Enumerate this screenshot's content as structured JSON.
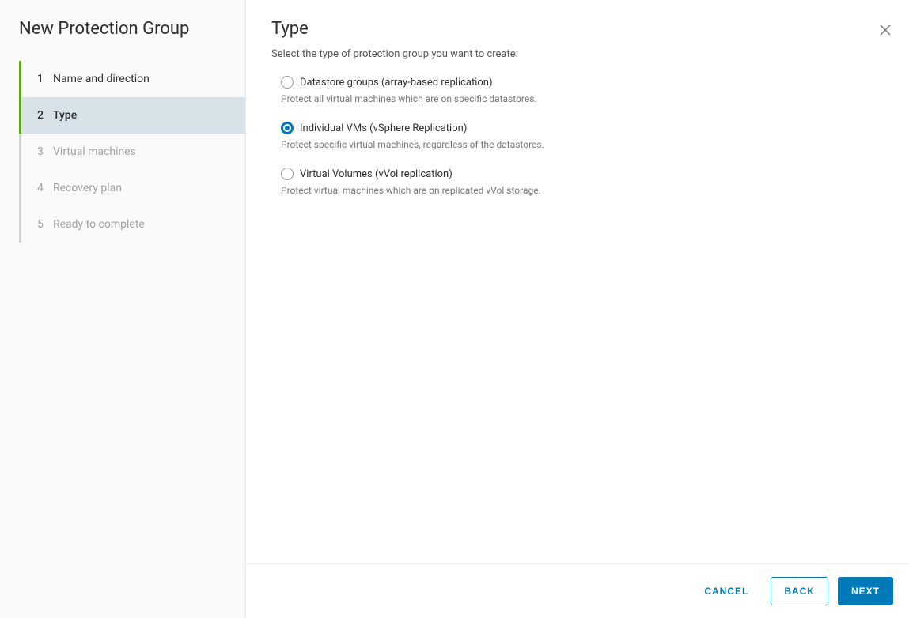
{
  "sidebar": {
    "title": "New Protection Group",
    "steps": [
      {
        "num": "1",
        "label": "Name and direction",
        "state": "completed"
      },
      {
        "num": "2",
        "label": "Type",
        "state": "current"
      },
      {
        "num": "3",
        "label": "Virtual machines",
        "state": "pending"
      },
      {
        "num": "4",
        "label": "Recovery plan",
        "state": "pending"
      },
      {
        "num": "5",
        "label": "Ready to complete",
        "state": "pending"
      }
    ]
  },
  "content": {
    "title": "Type",
    "subtitle": "Select the type of protection group you want to create:",
    "options": [
      {
        "label": "Datastore groups (array-based replication)",
        "description": "Protect all virtual machines which are on specific datastores.",
        "selected": false
      },
      {
        "label": "Individual VMs (vSphere Replication)",
        "description": "Protect specific virtual machines, regardless of the datastores.",
        "selected": true
      },
      {
        "label": "Virtual Volumes (vVol replication)",
        "description": "Protect virtual machines which are on replicated vVol storage.",
        "selected": false
      }
    ]
  },
  "footer": {
    "cancel": "Cancel",
    "back": "Back",
    "next": "Next"
  }
}
